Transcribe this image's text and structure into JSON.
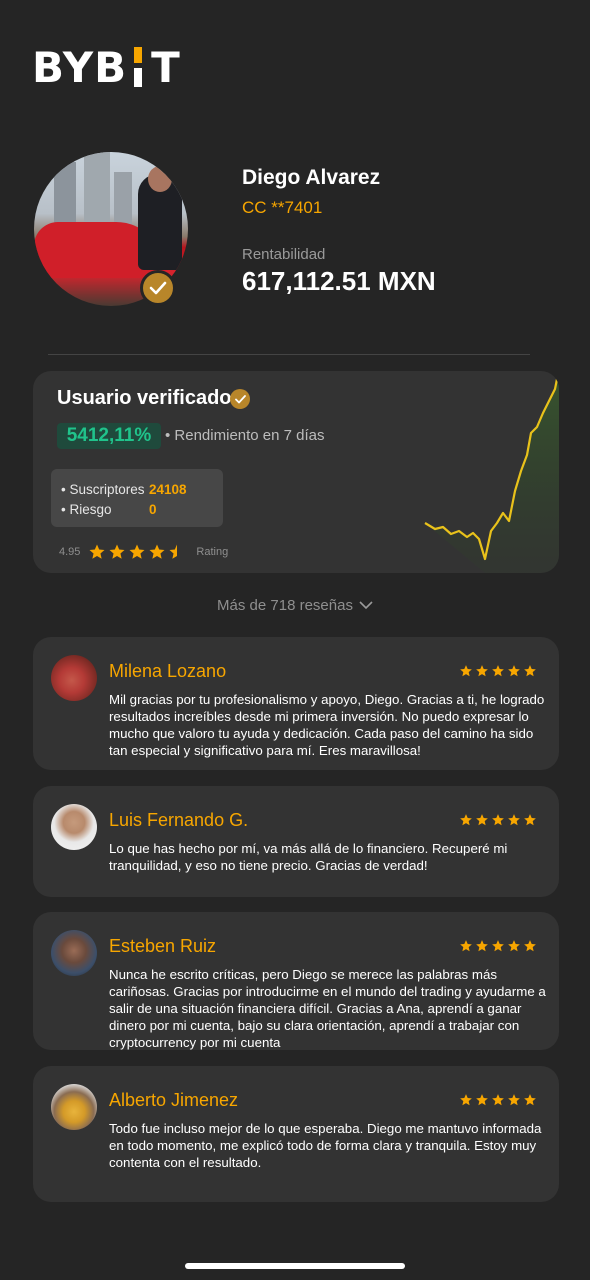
{
  "brand": {
    "logo_left": "BYB",
    "logo_right": "T",
    "accent": "#f7a600"
  },
  "profile": {
    "name": "Diego Alvarez",
    "account": "CC **7401",
    "profit_label": "Rentabilidad",
    "profit_value": "617,112.51 MXN"
  },
  "verified_card": {
    "title": "Usuario verificado",
    "performance": "5412,11%",
    "performance_label": "• Rendimiento en 7 días",
    "stats": [
      {
        "label": "• Suscriptores",
        "value": "24108"
      },
      {
        "label": "• Riesgo",
        "value": "0"
      }
    ],
    "rating_value": "4.95",
    "rating_stars": 4.5,
    "rating_label": "Rating"
  },
  "more_reviews": "Más de 718 reseñas",
  "reviews": [
    {
      "name": "Milena Lozano",
      "stars": 5,
      "text": "Mil gracias por tu profesionalismo y apoyo, Diego. Gracias a ti, he logrado resultados increíbles desde mi primera inversión. No puedo expresar lo mucho que valoro tu ayuda y dedicación. Cada paso del camino ha sido tan especial y significativo para mí. Eres maravillosa!"
    },
    {
      "name": "Luis Fernando G.",
      "stars": 5,
      "text": "Lo que has hecho por mí, va más allá de lo financiero. Recuperé mi tranquilidad, y eso no tiene precio. Gracias de verdad!"
    },
    {
      "name": "Esteben Ruiz",
      "stars": 5,
      "text": "Nunca he escrito críticas, pero Diego se merece las palabras más cariñosas. Gracias por introducirme en el mundo del trading y ayudarme a salir de una situación financiera difícil. Gracias a Ana, aprendí a ganar dinero por mi cuenta, bajo su clara orientación, aprendí a trabajar con cryptocurrency por mi cuenta"
    },
    {
      "name": "Alberto Jimenez",
      "stars": 5,
      "text": "Todo fue incluso mejor de lo que esperaba. Diego me mantuvo informada en todo momento, me explicó todo de forma clara y tranquila. Estoy muy contenta con el resultado."
    }
  ],
  "colors": {
    "positive": "#20c38b",
    "card": "#333333",
    "background": "#252525",
    "chart_line": "#e9c21b"
  }
}
